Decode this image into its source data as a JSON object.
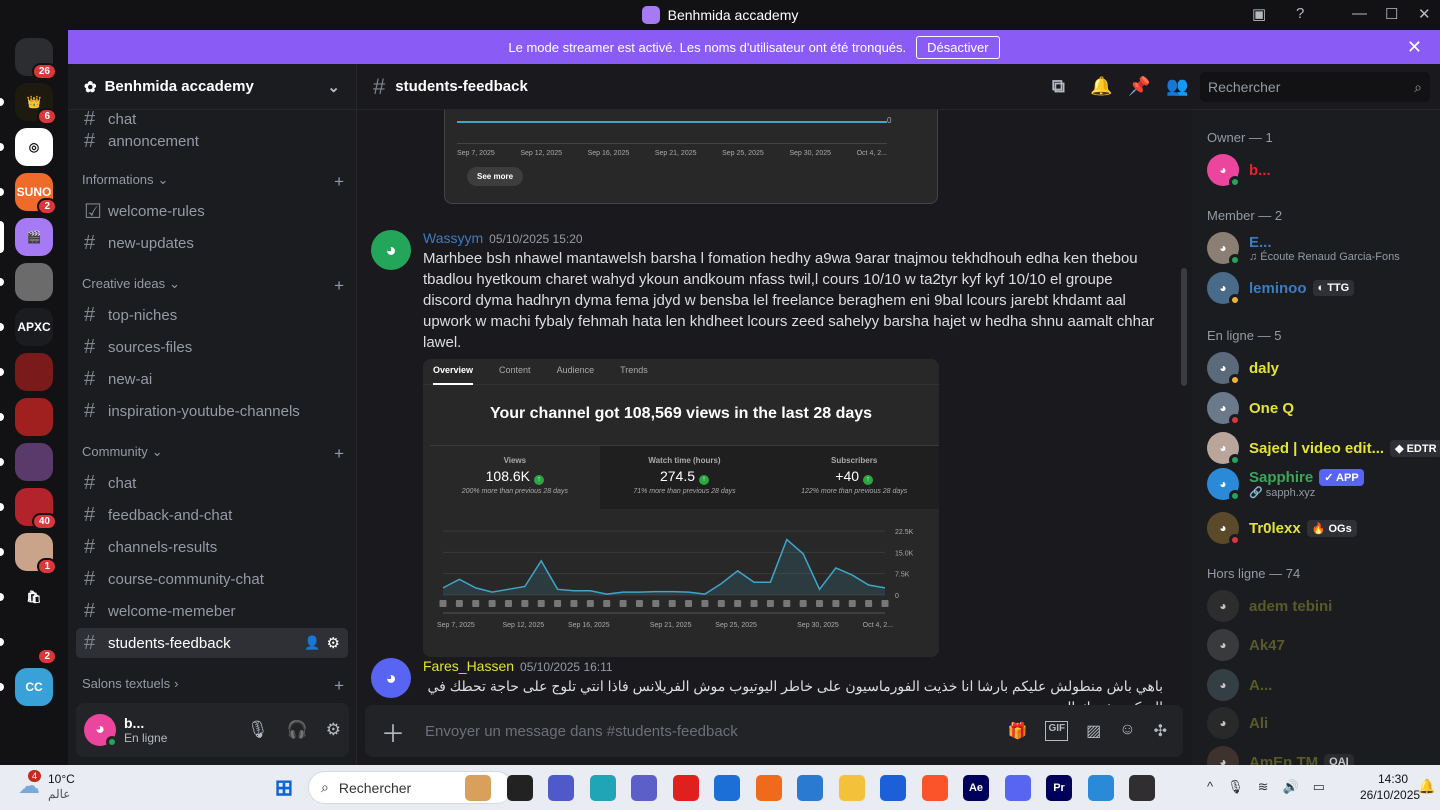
{
  "window": {
    "title": "Benhmida accademy"
  },
  "servers": [
    {
      "label": "",
      "badge": "26",
      "color": "#2b2d31"
    },
    {
      "label": "👑",
      "badge": "6",
      "color": "#1e1a10"
    },
    {
      "label": "◎",
      "badge": "",
      "color": "#ffffff"
    },
    {
      "label": "SUNO",
      "badge": "2",
      "color": "#f06a2a"
    },
    {
      "label": "🎬",
      "badge": "",
      "color": "#a77af5"
    },
    {
      "label": "",
      "badge": "",
      "color": "#6b6b6b"
    },
    {
      "label": "APXC",
      "badge": "",
      "color": "#1b1c20"
    },
    {
      "label": "",
      "badge": "",
      "color": "#7a1a1a"
    },
    {
      "label": "",
      "badge": "",
      "color": "#a02020"
    },
    {
      "label": "",
      "badge": "",
      "color": "#5a3a6a"
    },
    {
      "label": "",
      "badge": "40",
      "color": "#b3232b"
    },
    {
      "label": "",
      "badge": "1",
      "color": "#c9a48a"
    },
    {
      "label": "🛍",
      "badge": "",
      "color": "#121214"
    },
    {
      "label": "",
      "badge": "2",
      "color": "#121214"
    },
    {
      "label": "CC",
      "badge": "",
      "color": "#3aa0d8"
    }
  ],
  "banner": {
    "text": "Le mode streamer est activé. Les noms d'utilisateur ont été tronqués.",
    "button": "Désactiver"
  },
  "guild": {
    "name": "Benhmida accademy"
  },
  "sidebar": {
    "items": [
      {
        "type": "channel",
        "label": "chat",
        "icon": "hash"
      },
      {
        "type": "channel",
        "label": "annoncement",
        "icon": "hash"
      },
      {
        "type": "category",
        "label": "Informations"
      },
      {
        "type": "channel",
        "label": "welcome-rules",
        "icon": "rules"
      },
      {
        "type": "channel",
        "label": "new-updates",
        "icon": "hash"
      },
      {
        "type": "category",
        "label": "Creative ideas"
      },
      {
        "type": "channel",
        "label": "top-niches",
        "icon": "hash"
      },
      {
        "type": "channel",
        "label": "sources-files",
        "icon": "hash"
      },
      {
        "type": "channel",
        "label": "new-ai",
        "icon": "hash"
      },
      {
        "type": "channel",
        "label": "inspiration-youtube-channels",
        "icon": "hash"
      },
      {
        "type": "category",
        "label": "Community"
      },
      {
        "type": "channel",
        "label": "chat",
        "icon": "hash"
      },
      {
        "type": "channel",
        "label": "feedback-and-chat",
        "icon": "hash"
      },
      {
        "type": "channel",
        "label": "channels-results",
        "icon": "hash"
      },
      {
        "type": "channel",
        "label": "course-community-chat",
        "icon": "hash"
      },
      {
        "type": "channel",
        "label": "welcome-memeber",
        "icon": "hash"
      },
      {
        "type": "channel",
        "label": "students-feedback",
        "icon": "hash",
        "active": true
      },
      {
        "type": "category",
        "label": "Salons textuels"
      }
    ]
  },
  "user": {
    "name": "b...",
    "status": "En ligne"
  },
  "channel": {
    "name": "students-feedback",
    "search_placeholder": "Rechercher"
  },
  "top_embed": {
    "dates": [
      "Sep 7, 2025",
      "Sep 12, 2025",
      "Sep 16, 2025",
      "Sep 21, 2025",
      "Sep 25, 2025",
      "Sep 30, 2025",
      "Oct 4, 2..."
    ],
    "y0": "0",
    "button": "See more"
  },
  "messages": [
    {
      "author": "Wassyym",
      "author_color": "#3e7bbf",
      "time": "05/10/2025 15:20",
      "text": "Marhbee bsh nhawel mantawelsh barsha l fomation hedhy a9wa 9arar tnajmou tekhdhouh edha ken thebou tbadlou hyetkoum charet wahyd ykoun andkoum nfass twil,l cours 10/10 w ta2tyr kyf kyf 10/10 el groupe discord dyma hadhryn dyma fema jdyd w bensba lel freelance beraghem eni 9bal lcours jarebt khdamt aal upwork w machi fybaly fehmah hata len khdheet lcours zeed sahelyy barsha hajet  w hedha shnu aamalt chhar lawel."
    },
    {
      "author": "Fares_Hassen",
      "author_color": "#e3e336",
      "time": "05/10/2025 16:11",
      "text": "باهي باش منطولش عليكم بارشا انا خذيت الفورماسيون على خاطر اليوتيوب موش الفريلانس فاذا انتي تلوج على حاجة تحطك في السكة وتفهمك اليوتيوب من"
    }
  ],
  "analytics": {
    "tabs": [
      "Overview",
      "Content",
      "Audience",
      "Trends"
    ],
    "headline": "Your channel got 108,569 views in the last 28 days",
    "cards": [
      {
        "label": "Views",
        "value": "108.6K",
        "note": "200% more than previous 28 days"
      },
      {
        "label": "Watch time (hours)",
        "value": "274.5",
        "note": "71% more than previous 28 days"
      },
      {
        "label": "Subscribers",
        "value": "+40",
        "note": "122% more than previous 28 days"
      }
    ]
  },
  "chart_data": {
    "type": "area",
    "title": "Views",
    "yticks": [
      "22.5K",
      "15.0K",
      "7.5K",
      "0"
    ],
    "ylim": [
      0,
      22500
    ],
    "xticks": [
      "Sep 7, 2025",
      "Sep 12, 2025",
      "Sep 16, 2025",
      "Sep 21, 2025",
      "Sep 25, 2025",
      "Sep 30, 2025",
      "Oct 4, 2..."
    ],
    "values": [
      2500,
      5500,
      2500,
      1000,
      2000,
      3000,
      12000,
      2000,
      1500,
      1500,
      300,
      1000,
      1000,
      1200,
      1200,
      1000,
      300,
      4000,
      8500,
      4500,
      4500,
      19500,
      14500,
      2000,
      9500,
      7000,
      3500,
      2500
    ],
    "line_color": "#3ea6c8"
  },
  "composer": {
    "placeholder": "Envoyer un message dans #students-feedback"
  },
  "members": {
    "groups": [
      {
        "title": "Owner — 1",
        "items": [
          {
            "name": "b...",
            "color": "#e5262b",
            "av": "#eb459e",
            "status": "#23a55a"
          }
        ]
      },
      {
        "title": "Member — 2",
        "items": [
          {
            "name": "E...",
            "color": "#3e7bbf",
            "av": "#8a7f72",
            "status": "#23a55a",
            "sub": "♫ Écoute Renaud Garcia-Fons"
          },
          {
            "name": "leminoo",
            "color": "#3e7bbf",
            "av": "#4a6a8a",
            "status": "#f0b232",
            "tag": "◐ TTG"
          }
        ]
      },
      {
        "title": "En ligne — 5",
        "items": [
          {
            "name": "daly",
            "color": "#e3e336",
            "av": "#5a6a7a",
            "status": "#f0b232"
          },
          {
            "name": "One Q",
            "color": "#e3e336",
            "av": "#6a7a8a",
            "status": "#da373c"
          },
          {
            "name": "Sajed | video edit...",
            "color": "#e3e336",
            "av": "#b9a59a",
            "status": "#23a55a",
            "tag": "◆ EDTR"
          },
          {
            "name": "Sapphire",
            "color": "#3ba55c",
            "av": "#2a8ad8",
            "status": "#23a55a",
            "tag": "✓ APP",
            "tagbg": "#5865f2",
            "sub": "🔗 sapph.xyz"
          },
          {
            "name": "Tr0lexx",
            "color": "#e3e336",
            "av": "#5a4a2a",
            "status": "#da373c",
            "tag": "🔥 OGs"
          }
        ]
      },
      {
        "title": "Hors ligne — 74",
        "items": [
          {
            "name": "adem tebini",
            "color": "#6e6f2a",
            "av": "#333"
          },
          {
            "name": "Ak47",
            "color": "#6e6f2a",
            "av": "#444"
          },
          {
            "name": "A...",
            "color": "#6e6f2a",
            "av": "#3d4a52"
          },
          {
            "name": "Ali",
            "color": "#6e6f2a",
            "av": "#2e2e2e"
          },
          {
            "name": "AmEn TM",
            "color": "#6e6f2a",
            "av": "#4a3a35",
            "tag": "OAI"
          }
        ]
      }
    ]
  },
  "taskbar": {
    "weather_temp": "10°C",
    "weather_desc": "عالم",
    "weather_badge": "4",
    "search": "Rechercher",
    "apps": [
      {
        "n": "paint",
        "c": "#d9a05b"
      },
      {
        "n": "terminal",
        "c": "#222"
      },
      {
        "n": "meet",
        "c": "#5059c9"
      },
      {
        "n": "edge",
        "c": "#1fa5b5"
      },
      {
        "n": "teams",
        "c": "#5b5fc7"
      },
      {
        "n": "opera",
        "c": "#e0201f"
      },
      {
        "n": "mail",
        "c": "#1d6fd8"
      },
      {
        "n": "firefox",
        "c": "#ef6a1a"
      },
      {
        "n": "whiteboard",
        "c": "#2a7ad2"
      },
      {
        "n": "explorer",
        "c": "#f3c13a"
      },
      {
        "n": "vscode-like",
        "c": "#1d5fd8"
      },
      {
        "n": "brave",
        "c": "#fb542b"
      },
      {
        "n": "after-effects",
        "c": "#00005b",
        "t": "Ae"
      },
      {
        "n": "discord",
        "c": "#5865f2"
      },
      {
        "n": "premiere",
        "c": "#00005b",
        "t": "Pr"
      },
      {
        "n": "photos",
        "c": "#2a8ad8"
      },
      {
        "n": "obs",
        "c": "#302e31"
      }
    ],
    "time": "14:30",
    "date": "26/10/2025"
  }
}
